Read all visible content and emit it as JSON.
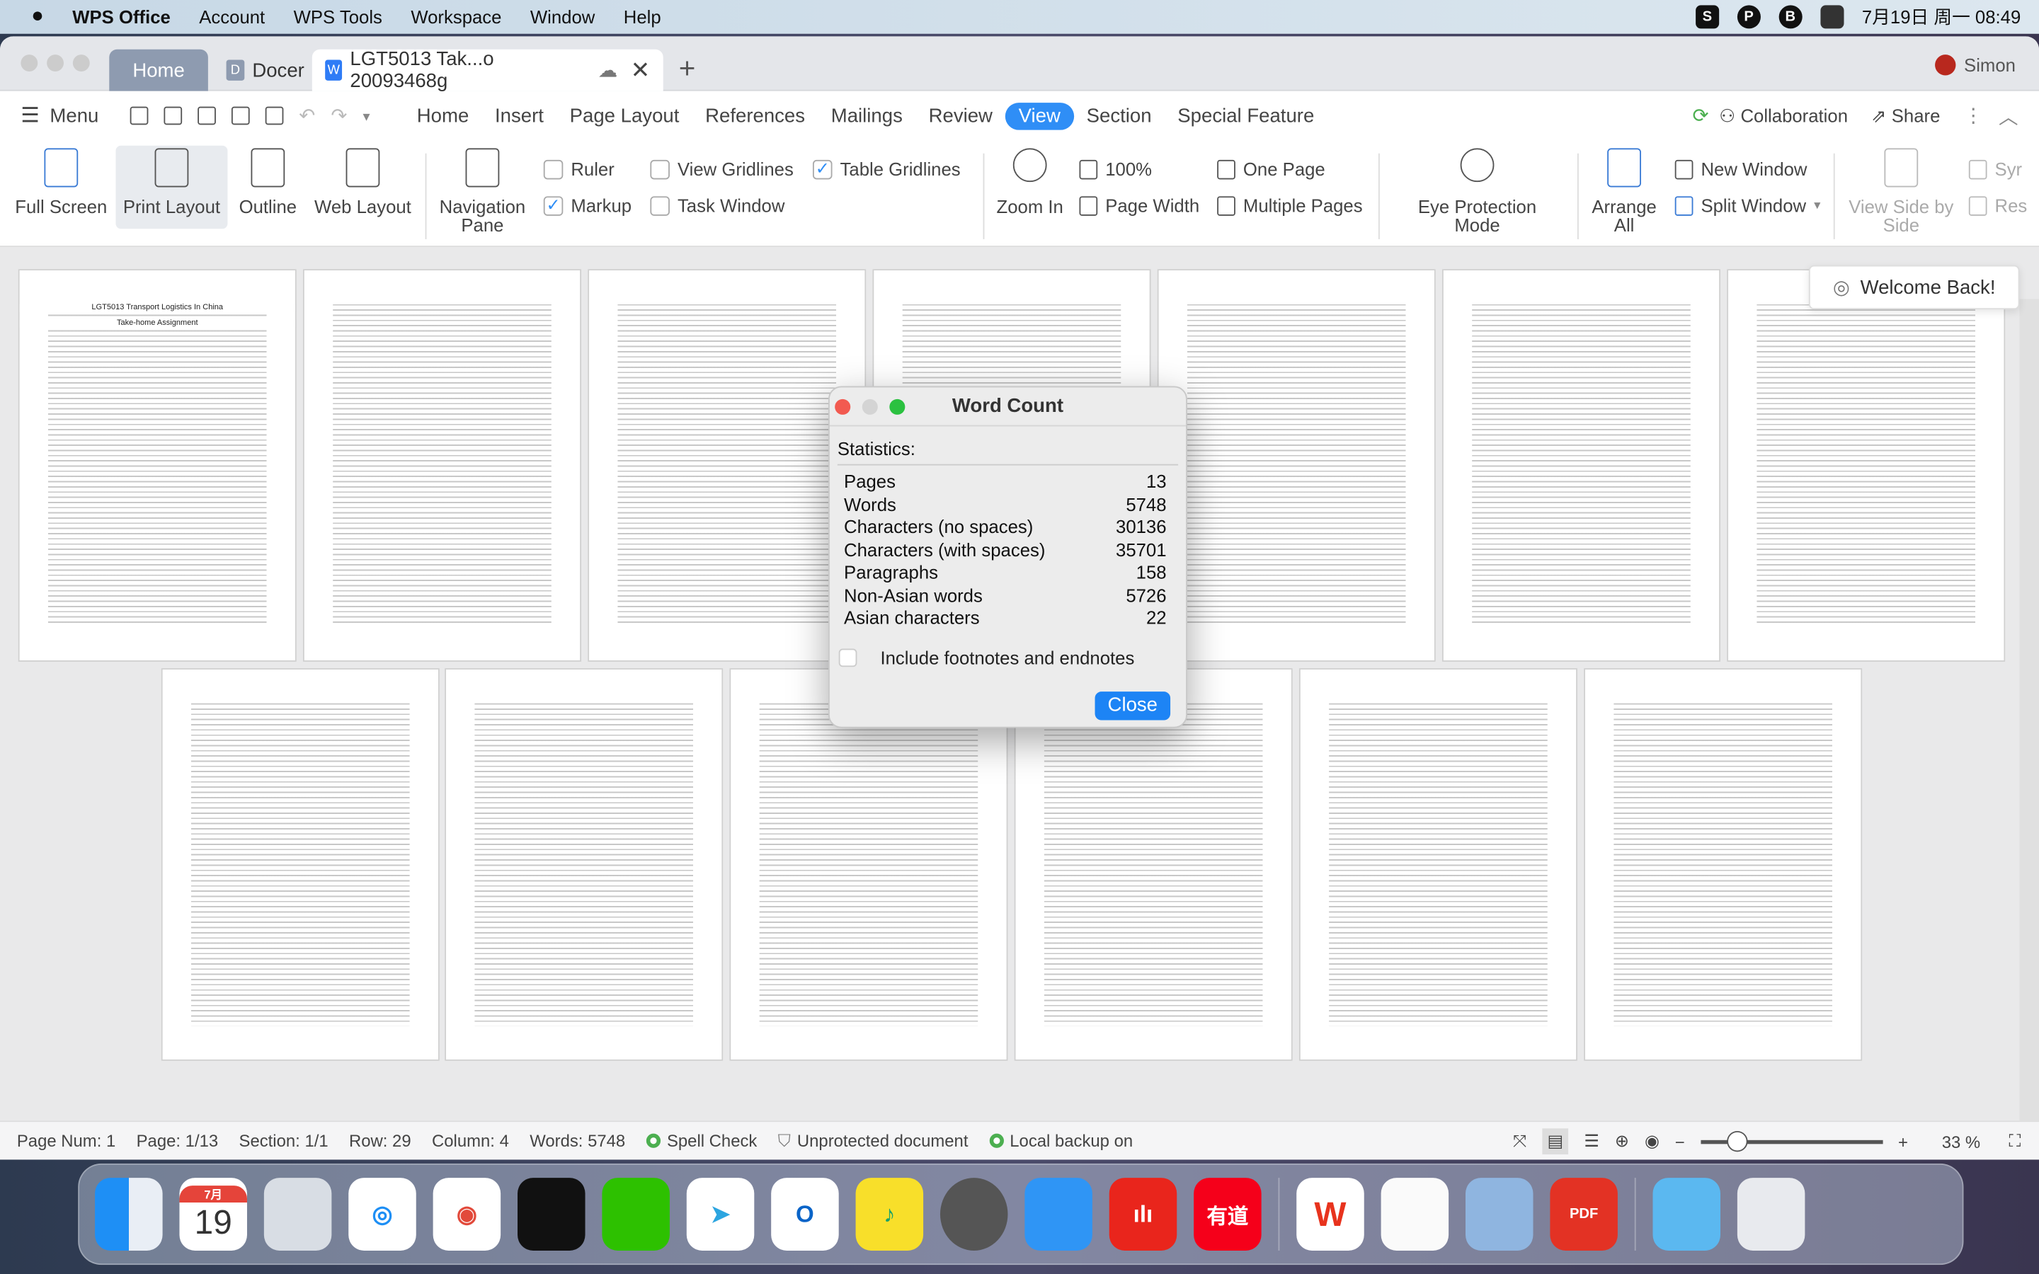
{
  "menubar": {
    "app": "WPS Office",
    "items": [
      "Account",
      "WPS Tools",
      "Workspace",
      "Window",
      "Help"
    ],
    "tray_icons": [
      "S",
      "P",
      "B"
    ],
    "clock": "7月19日 周一  08:49"
  },
  "tabs": {
    "home": "Home",
    "docer": "Docer",
    "document": "LGT5013 Tak...o 20093468g",
    "user": "Simon"
  },
  "toolbar": {
    "menu": "Menu",
    "tabs": [
      "Home",
      "Insert",
      "Page Layout",
      "References",
      "Mailings",
      "Review",
      "View",
      "Section",
      "Special Feature"
    ],
    "active_tab": "View",
    "collaboration": "Collaboration",
    "share": "Share"
  },
  "ribbon": {
    "full_screen": "Full Screen",
    "print_layout": "Print Layout",
    "outline": "Outline",
    "web_layout": "Web Layout",
    "navigation_pane": "Navigation Pane",
    "ruler": "Ruler",
    "markup": "Markup",
    "view_gridlines": "View Gridlines",
    "task_window": "Task Window",
    "table_gridlines": "Table Gridlines",
    "zoom_in": "Zoom In",
    "zoom_100": "100%",
    "page_width": "Page Width",
    "one_page": "One Page",
    "multiple_pages": "Multiple Pages",
    "eye_protection": "Eye Protection Mode",
    "arrange_all": "Arrange All",
    "new_window": "New Window",
    "split_window": "Split Window",
    "side_by_side": "View Side by Side",
    "sync": "Syr",
    "reset": "Res",
    "checks": {
      "ruler": false,
      "markup": true,
      "view_gridlines": false,
      "task_window": false,
      "table_gridlines": true
    }
  },
  "document": {
    "title": "LGT5013 Transport Logistics In China",
    "subtitle": "Take-home Assignment",
    "page_count": 13
  },
  "welcome": "Welcome Back!",
  "dialog": {
    "title": "Word Count",
    "stats_label": "Statistics:",
    "rows": [
      {
        "label": "Pages",
        "value": "13"
      },
      {
        "label": "Words",
        "value": "5748"
      },
      {
        "label": "Characters (no spaces)",
        "value": "30136"
      },
      {
        "label": "Characters (with spaces)",
        "value": "35701"
      },
      {
        "label": "Paragraphs",
        "value": "158"
      },
      {
        "label": "Non-Asian words",
        "value": "5726"
      },
      {
        "label": "Asian characters",
        "value": "22"
      }
    ],
    "include_label": "Include footnotes and endnotes",
    "include_checked": false,
    "close": "Close"
  },
  "status": {
    "page_num": "Page Num: 1",
    "page": "Page: 1/13",
    "section": "Section: 1/1",
    "row": "Row: 29",
    "column": "Column: 4",
    "words": "Words: 5748",
    "spell": "Spell Check",
    "protect": "Unprotected document",
    "backup": "Local backup on",
    "zoom": "33 %"
  },
  "dock": {
    "calendar_month": "7月",
    "calendar_day": "19",
    "youdao": "有道",
    "pdf": "PDF"
  }
}
